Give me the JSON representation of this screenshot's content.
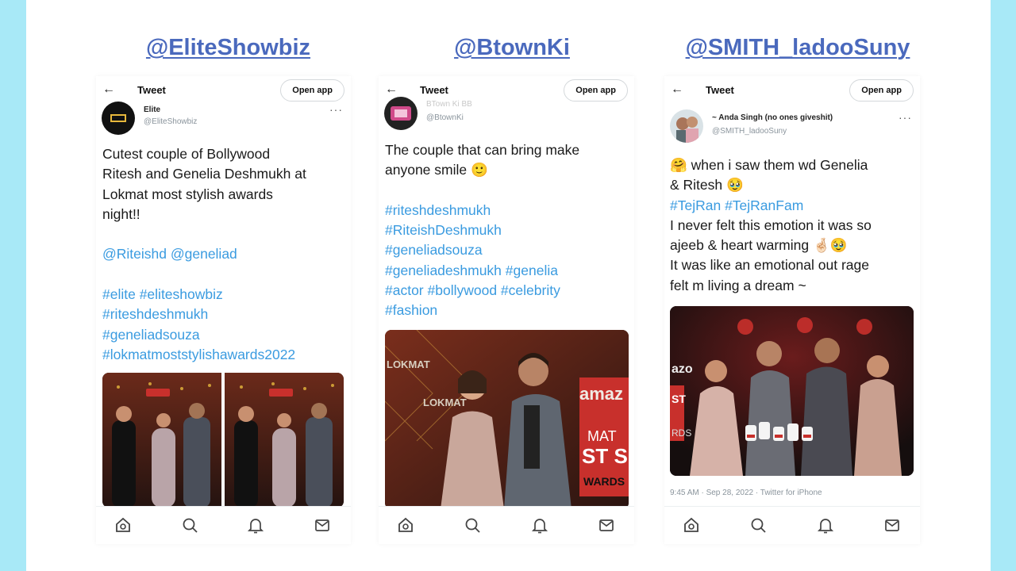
{
  "colors": {
    "background": "#a8e9f7",
    "handle": "#4a69bd",
    "hashtag": "#3a9be0"
  },
  "panels": [
    {
      "handle": "@EliteShowbiz",
      "topbar": {
        "title": "Tweet",
        "open_app": "Open app"
      },
      "user": {
        "name": "Elite",
        "handle": "@EliteShowbiz",
        "avatar_text": "Elite"
      },
      "text_lines": [
        "Cutest couple of Bollywood",
        "Ritesh and Genelia Deshmukh at",
        "Lokmat most stylish awards",
        "night!!"
      ],
      "mentions": "@Riteishd @geneliad",
      "hashtags": [
        "#elite #eliteshowbiz",
        "#riteshdeshmukh",
        "#geneliadsouza",
        "#lokmatmoststylishawards2022"
      ],
      "photo_alt": "couple at Lokmat awards"
    },
    {
      "handle": "@BtownKi",
      "topbar": {
        "title": "Tweet",
        "open_app": "Open app"
      },
      "user": {
        "name": "BTown Ki BB",
        "handle": "@BtownKi",
        "avatar_text": ""
      },
      "text_lines": [
        "The couple that can bring make",
        "anyone smile 🙂"
      ],
      "hashtags": [
        "#riteshdeshmukh",
        "#RiteishDeshmukh",
        "#geneliadsouza",
        "#geneliadeshmukh #genelia",
        "#actor #bollywood #celebrity",
        "#fashion"
      ],
      "photo_text": {
        "lokmat": "LOKMAT",
        "amazon": "amaz",
        "mat": "MAT",
        "st": "ST S",
        "awards": "WARDS"
      }
    },
    {
      "handle": "@SMITH_ladooSuny",
      "topbar": {
        "title": "Tweet",
        "open_app": "Open app"
      },
      "user": {
        "name": "~ Anda Singh (no ones giveshit)",
        "handle": "@SMITH_ladooSuny"
      },
      "text_lines": [
        "🤗 when i saw them wd Genelia",
        "& Ritesh 🥹"
      ],
      "hashtags_line": "#TejRan #TejRanFam",
      "text_lines2": [
        "I never felt this emotion it was so",
        "ajeeb & heart warming 🤞🏻🥹",
        "It was like an emotional out rage",
        "felt m living a dream ~"
      ],
      "meta": "9:45 AM · Sep 28, 2022 · Twitter for iPhone",
      "photo_text": {
        "amazon": "azo",
        "st": "ST",
        "rds": "RDS"
      }
    }
  ],
  "icons": [
    "home-icon",
    "search-icon",
    "bell-icon",
    "mail-icon"
  ]
}
